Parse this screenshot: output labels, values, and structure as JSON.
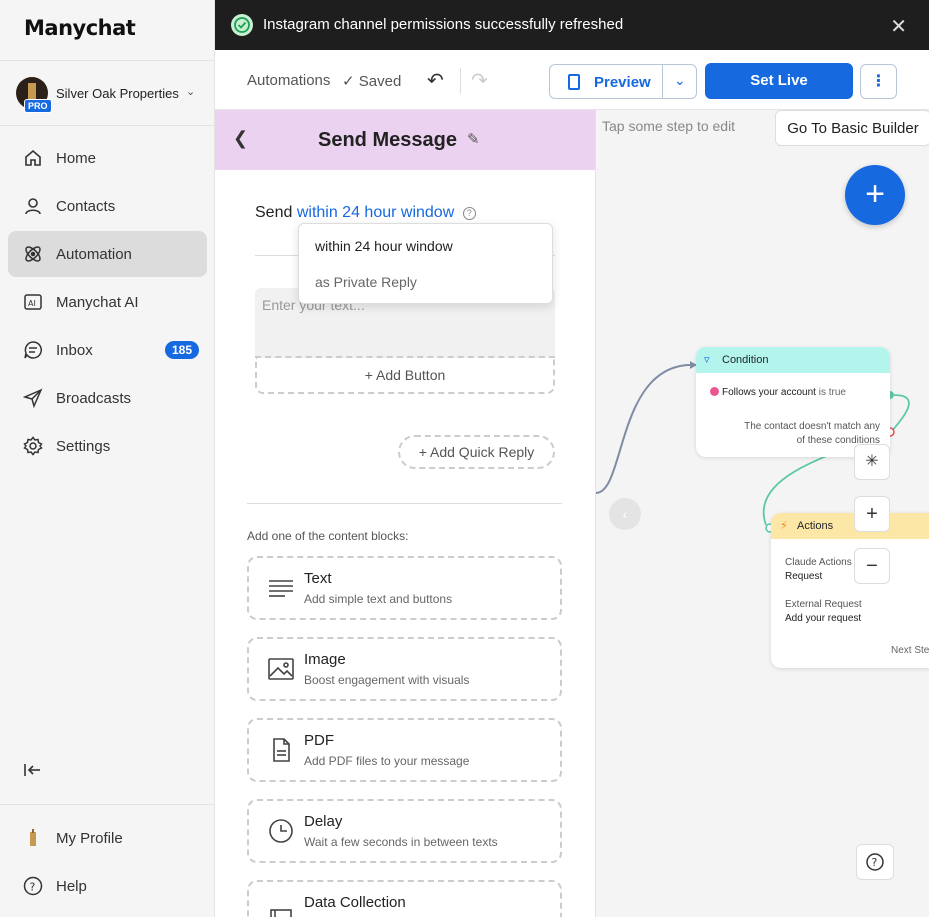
{
  "app": {
    "logo": "Manychat"
  },
  "account": {
    "name": "Silver Oak Properties",
    "badge": "PRO"
  },
  "nav": {
    "home": "Home",
    "contacts": "Contacts",
    "automation": "Automation",
    "manychat_ai": "Manychat AI",
    "inbox": "Inbox",
    "inbox_count": "185",
    "broadcasts": "Broadcasts",
    "settings": "Settings",
    "my_profile": "My Profile",
    "help": "Help"
  },
  "toast": {
    "message": "Instagram channel permissions successfully refreshed"
  },
  "toolbar": {
    "breadcrumb": "Automations",
    "saved": "Saved",
    "preview": "Preview",
    "set_live": "Set Live"
  },
  "panel": {
    "title": "Send Message",
    "send_prefix": "Send",
    "send_mode": "within 24 hour window",
    "text_placeholder": "Enter your text...",
    "add_button": "+ Add Button",
    "add_quick_reply": "+ Add Quick Reply",
    "blocks_title": "Add one of the content blocks:",
    "blocks": [
      {
        "name": "Text",
        "desc": "Add simple text and buttons",
        "icon": "text-lines-icon"
      },
      {
        "name": "Image",
        "desc": "Boost engagement with visuals",
        "icon": "image-icon"
      },
      {
        "name": "PDF",
        "desc": "Add PDF files to your message",
        "icon": "document-icon"
      },
      {
        "name": "Delay",
        "desc": "Wait a few seconds in between texts",
        "icon": "clock-icon"
      },
      {
        "name": "Data Collection",
        "desc": "",
        "icon": "form-icon"
      }
    ]
  },
  "dropdown": {
    "options": [
      "within 24 hour window",
      "as Private Reply"
    ]
  },
  "canvas": {
    "hint": "Tap some step to edit",
    "basic_builder": "Go To Basic Builder",
    "condition": {
      "title": "Condition",
      "rule_label": "Follows your account",
      "rule_value": "is true",
      "fallback_line1": "The contact doesn't match any",
      "fallback_line2": "of these conditions"
    },
    "actions": {
      "title": "Actions",
      "item1_label": "Claude Actions",
      "item1_value": "Request",
      "item2_label": "External Request",
      "item2_value": "Add your request",
      "next": "Next Step"
    }
  },
  "colors": {
    "brand": "#1769e0",
    "panel_header": "#ecd2f1",
    "condition_header": "#b3f5ec",
    "actions_header": "#fce7a6"
  }
}
